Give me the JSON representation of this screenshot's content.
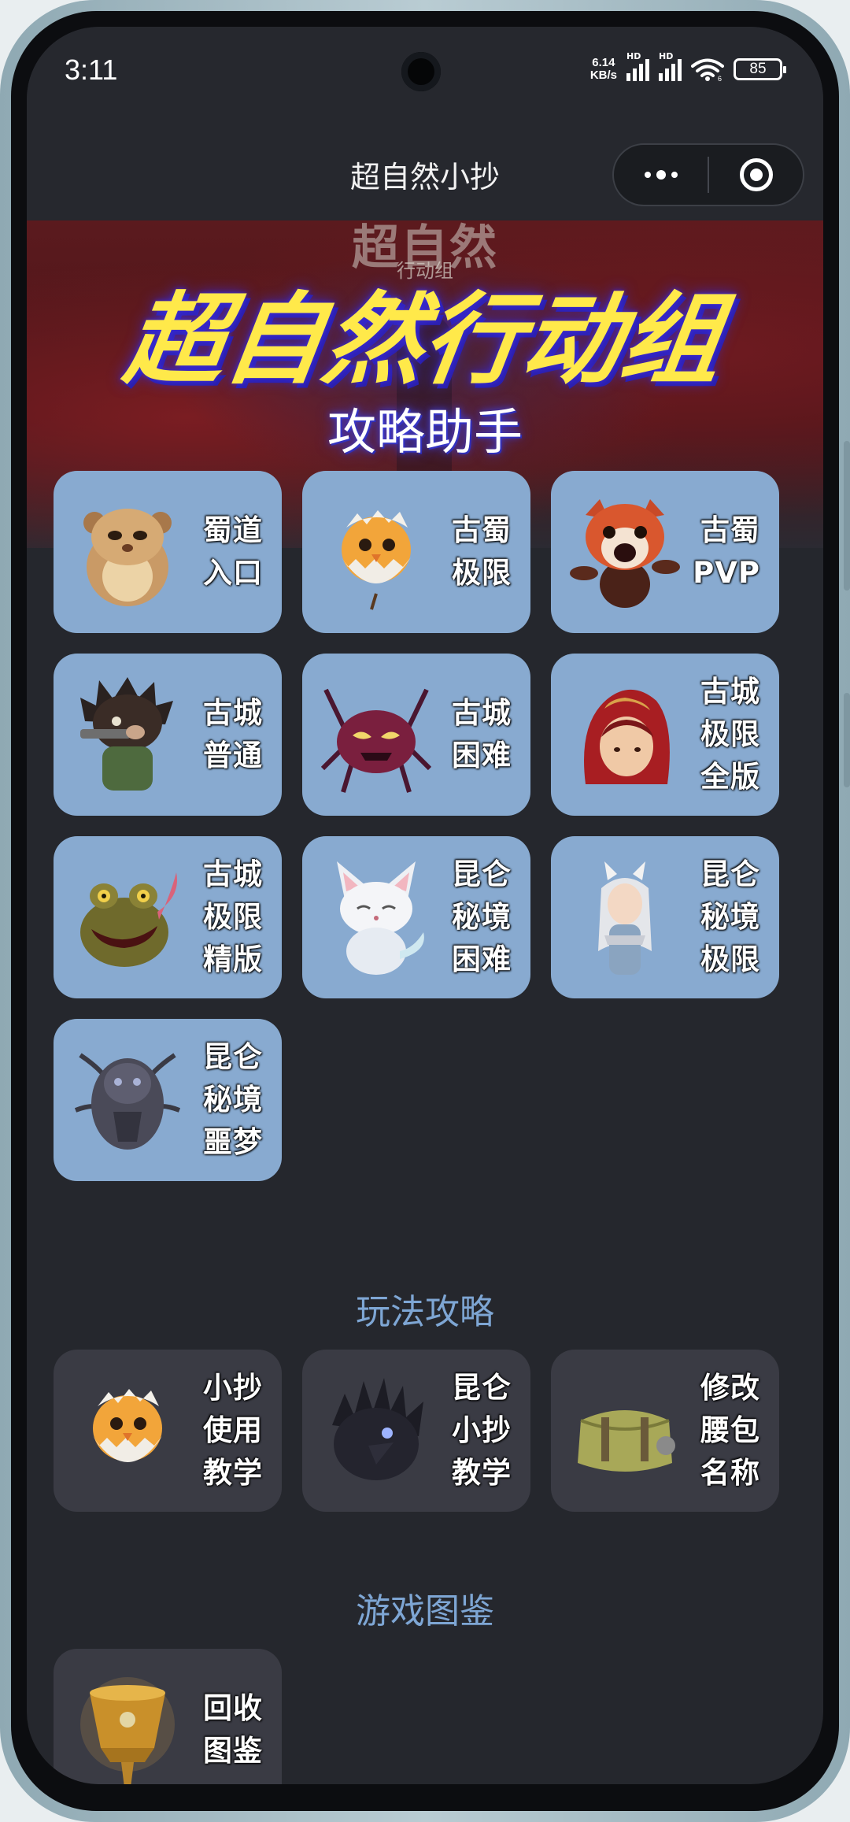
{
  "status": {
    "time": "3:11",
    "net_speed_value": "6.14",
    "net_speed_unit": "KB/s",
    "signal1_tag": "HD",
    "signal2_tag": "HD",
    "wifi_tag": "6",
    "battery": "85"
  },
  "navbar": {
    "title": "超自然小抄"
  },
  "banner": {
    "game_logo": "超自然",
    "game_logo_sub": "行动组",
    "title": "超自然行动组",
    "subtitle": "攻略助手"
  },
  "guides": [
    {
      "icon": "hamster-icon",
      "line1": "蜀道",
      "line2": "入口",
      "line3": ""
    },
    {
      "icon": "chick-egg-icon",
      "line1": "古蜀",
      "line2": "极限",
      "line3": ""
    },
    {
      "icon": "red-panda-icon",
      "line1": "古蜀",
      "line2": "PVP",
      "line3": ""
    },
    {
      "icon": "hedgehog-soldier-icon",
      "line1": "古城",
      "line2": "普通",
      "line3": ""
    },
    {
      "icon": "spider-monster-icon",
      "line1": "古城",
      "line2": "困难",
      "line3": ""
    },
    {
      "icon": "red-hood-girl-icon",
      "line1": "古城",
      "line2": "极限",
      "line3": "全版"
    },
    {
      "icon": "toad-monster-icon",
      "line1": "古城",
      "line2": "极限",
      "line3": "精版"
    },
    {
      "icon": "white-fox-icon",
      "line1": "昆仑",
      "line2": "秘境",
      "line3": "困难"
    },
    {
      "icon": "fox-girl-icon",
      "line1": "昆仑",
      "line2": "秘境",
      "line3": "极限"
    },
    {
      "icon": "dark-demon-icon",
      "line1": "昆仑",
      "line2": "秘境",
      "line3": "噩梦"
    }
  ],
  "section_gameplay": {
    "title": "玩法攻略",
    "items": [
      {
        "icon": "chick-egg-icon",
        "line1": "小抄",
        "line2": "使用",
        "line3": "教学"
      },
      {
        "icon": "black-crow-icon",
        "line1": "昆仑",
        "line2": "小抄",
        "line3": "教学"
      },
      {
        "icon": "backpack-icon",
        "line1": "修改",
        "line2": "腰包",
        "line3": "名称"
      }
    ]
  },
  "section_codex": {
    "title": "游戏图鉴",
    "items": [
      {
        "icon": "golden-cup-icon",
        "line1": "回收",
        "line2": "图鉴",
        "line3": ""
      }
    ]
  },
  "colors": {
    "card_blue": "#88aad0",
    "card_dark": "#3a3b44",
    "section_title": "#7ea6d4",
    "banner_title": "#ffe94a",
    "background": "#25272d"
  }
}
